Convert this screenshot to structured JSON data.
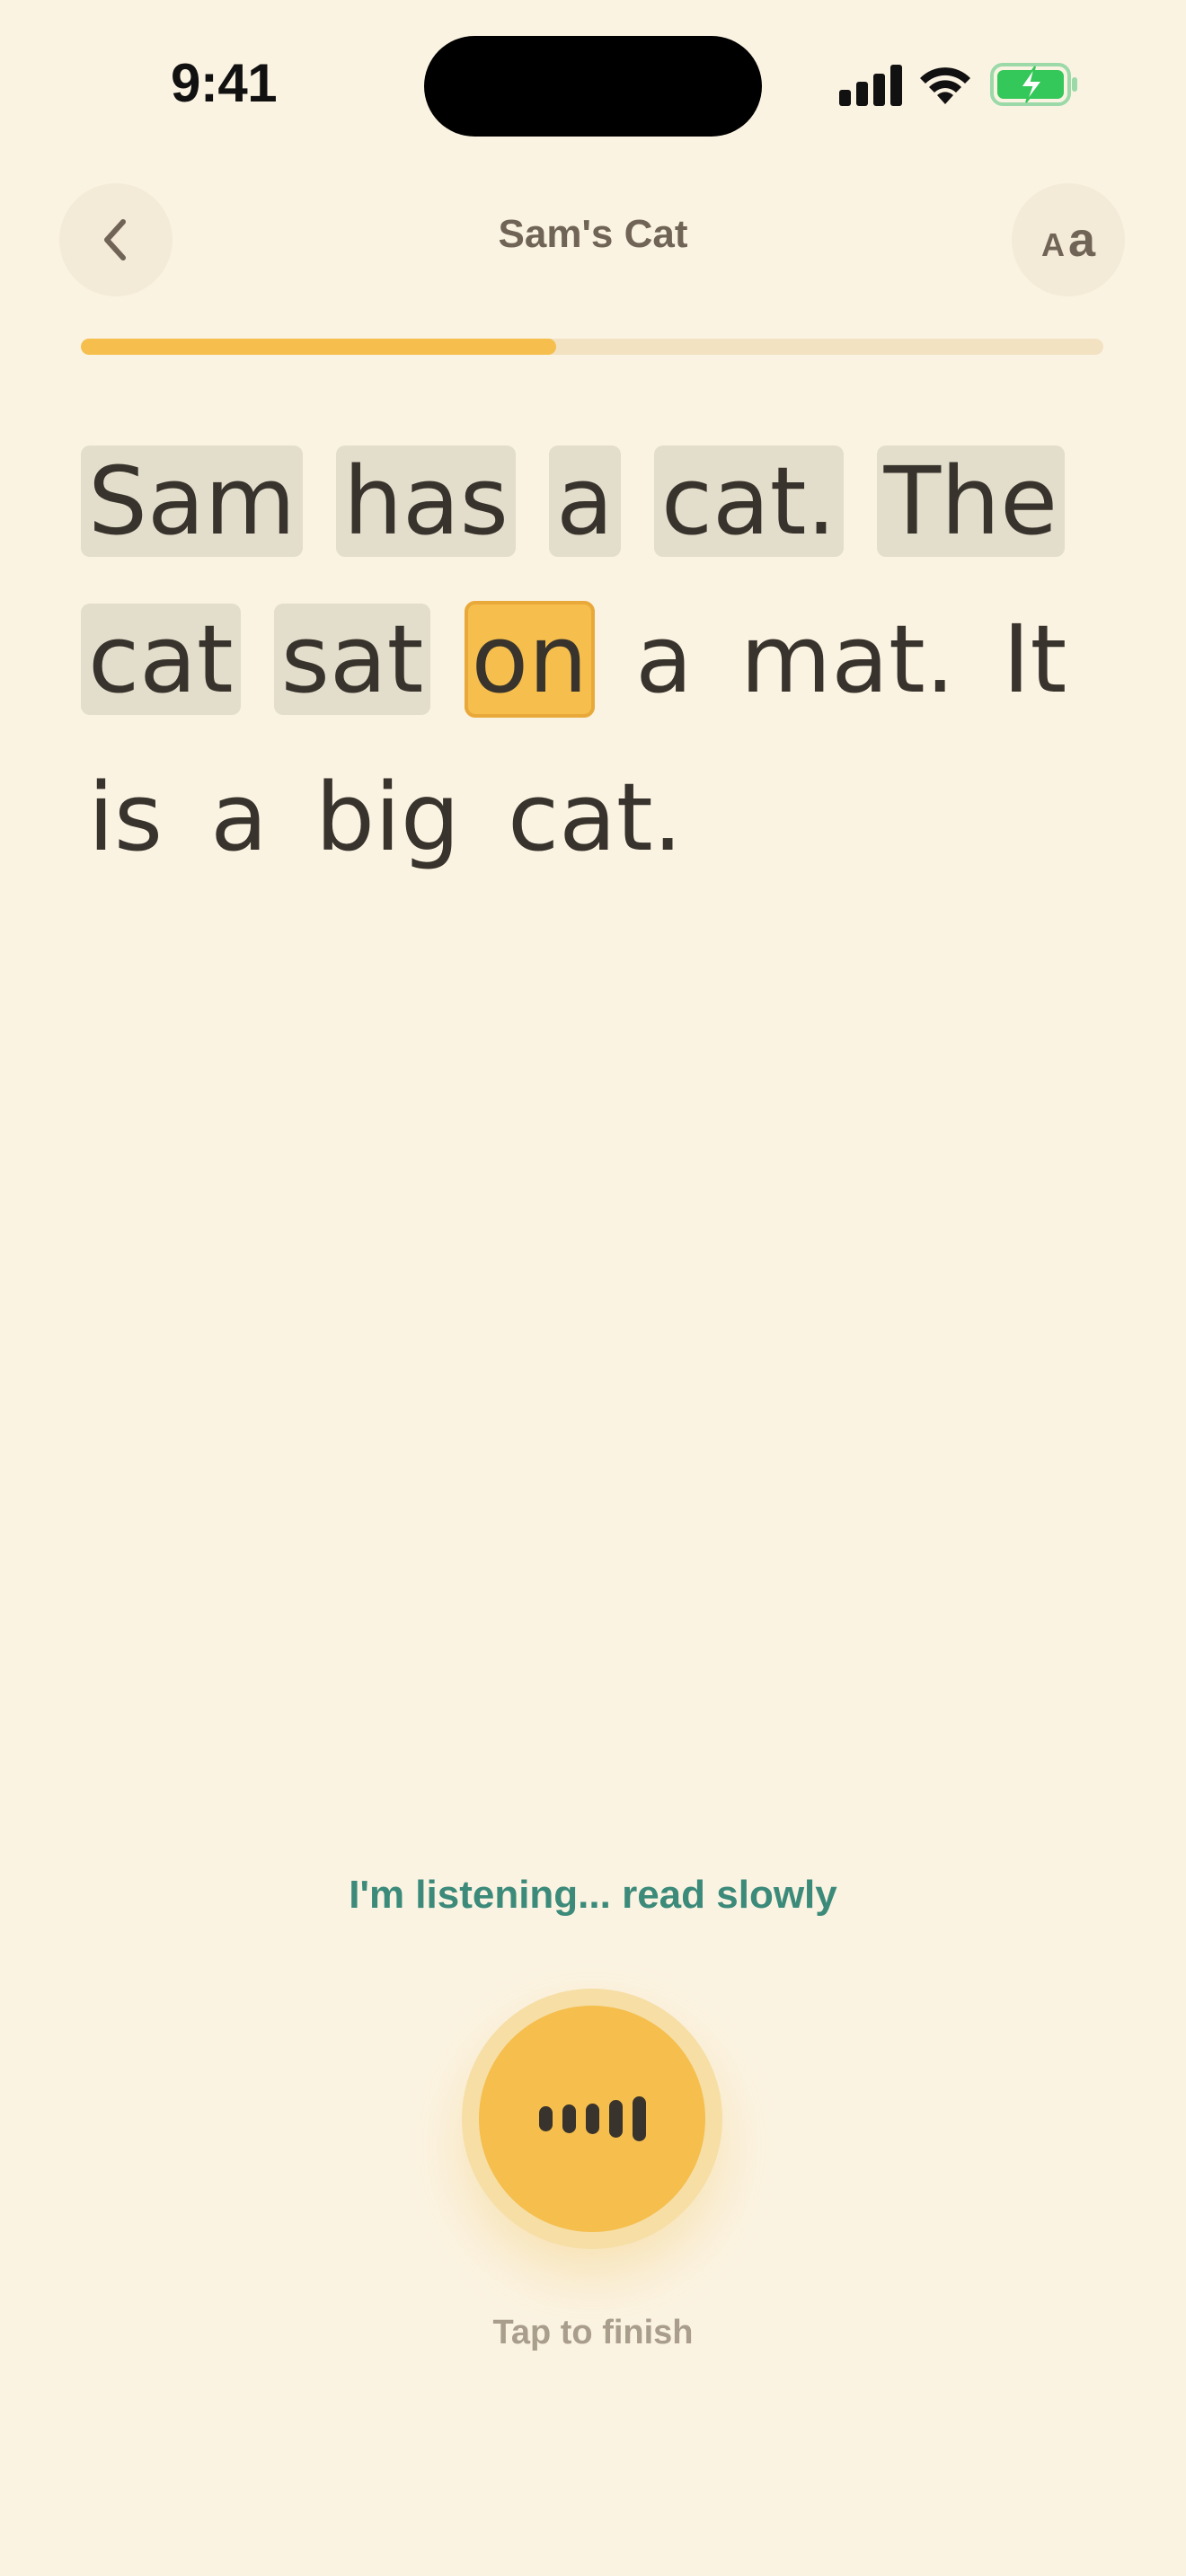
{
  "status_bar": {
    "time": "9:41",
    "icons": [
      "signal-icon",
      "wifi-icon",
      "battery-charging-icon"
    ],
    "battery_color": "#34C759"
  },
  "header": {
    "title": "Sam's Cat",
    "back_icon": "chevron-left-icon",
    "text_size_label_small": "A",
    "text_size_label_big": "a"
  },
  "progress": {
    "fraction": 0.465,
    "fill_color": "#F5BE4D",
    "track_color": "#F2E2C2"
  },
  "passage": {
    "words": [
      {
        "text": "Sam",
        "state": "read"
      },
      {
        "text": "has",
        "state": "read"
      },
      {
        "text": "a",
        "state": "read"
      },
      {
        "text": "cat.",
        "state": "read"
      },
      {
        "text": "The",
        "state": "read"
      },
      {
        "text": "cat",
        "state": "read"
      },
      {
        "text": "sat",
        "state": "read"
      },
      {
        "text": "on",
        "state": "current"
      },
      {
        "text": "a",
        "state": "unread"
      },
      {
        "text": "mat.",
        "state": "unread"
      },
      {
        "text": "It",
        "state": "unread"
      },
      {
        "text": "is",
        "state": "unread"
      },
      {
        "text": "a",
        "state": "unread"
      },
      {
        "text": "big",
        "state": "unread"
      },
      {
        "text": "cat.",
        "state": "unread"
      }
    ]
  },
  "listening": {
    "status_text": "I'm listening... read slowly",
    "status_color": "#3C8A7A",
    "mic_icon": "waveform-icon",
    "hint": "Tap to finish"
  },
  "colors": {
    "background": "#FBF3E2",
    "accent": "#F5BE4D",
    "read_word_bg": "#E3DDCB",
    "text": "#38332C"
  }
}
